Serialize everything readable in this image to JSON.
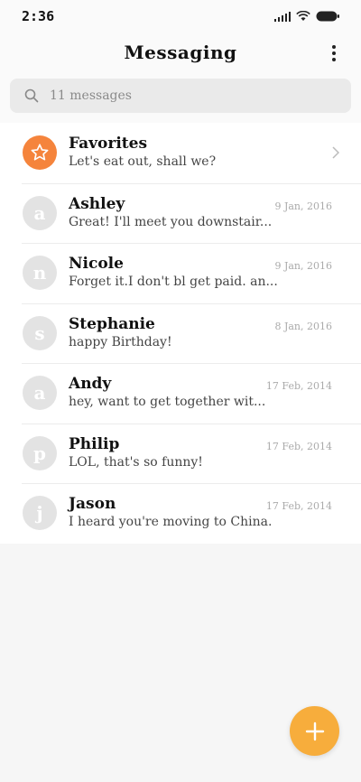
{
  "status_bar": {
    "time": "2:36"
  },
  "header": {
    "title": "Messaging"
  },
  "search": {
    "placeholder": "11 messages"
  },
  "favorites": {
    "name": "Favorites",
    "preview": "Let's eat out, shall we?"
  },
  "conversations": [
    {
      "initial": "a",
      "name": "Ashley",
      "date": "9 Jan, 2016",
      "preview": "Great! I'll meet you downstair..."
    },
    {
      "initial": "n",
      "name": "Nicole",
      "date": "9 Jan, 2016",
      "preview": "Forget it.I don't bl get paid. an..."
    },
    {
      "initial": "s",
      "name": "Stephanie",
      "date": "8 Jan, 2016",
      "preview": "happy Birthday!"
    },
    {
      "initial": "a",
      "name": "Andy",
      "date": "17 Feb, 2014",
      "preview": "hey, want to get together wit..."
    },
    {
      "initial": "p",
      "name": "Philip",
      "date": "17 Feb, 2014",
      "preview": "LOL, that's so funny!"
    },
    {
      "initial": "j",
      "name": "Jason",
      "date": "17 Feb, 2014",
      "preview": "I heard you're moving to China."
    }
  ],
  "icons": {
    "search": "search-icon",
    "more": "more-vertical-icon",
    "star": "star-icon",
    "chevron": "chevron-right-icon",
    "add": "plus-icon"
  },
  "colors": {
    "favorites_avatar": "#f5843c",
    "fab": "#f7ad3c",
    "avatar_placeholder": "#e3e3e3"
  }
}
